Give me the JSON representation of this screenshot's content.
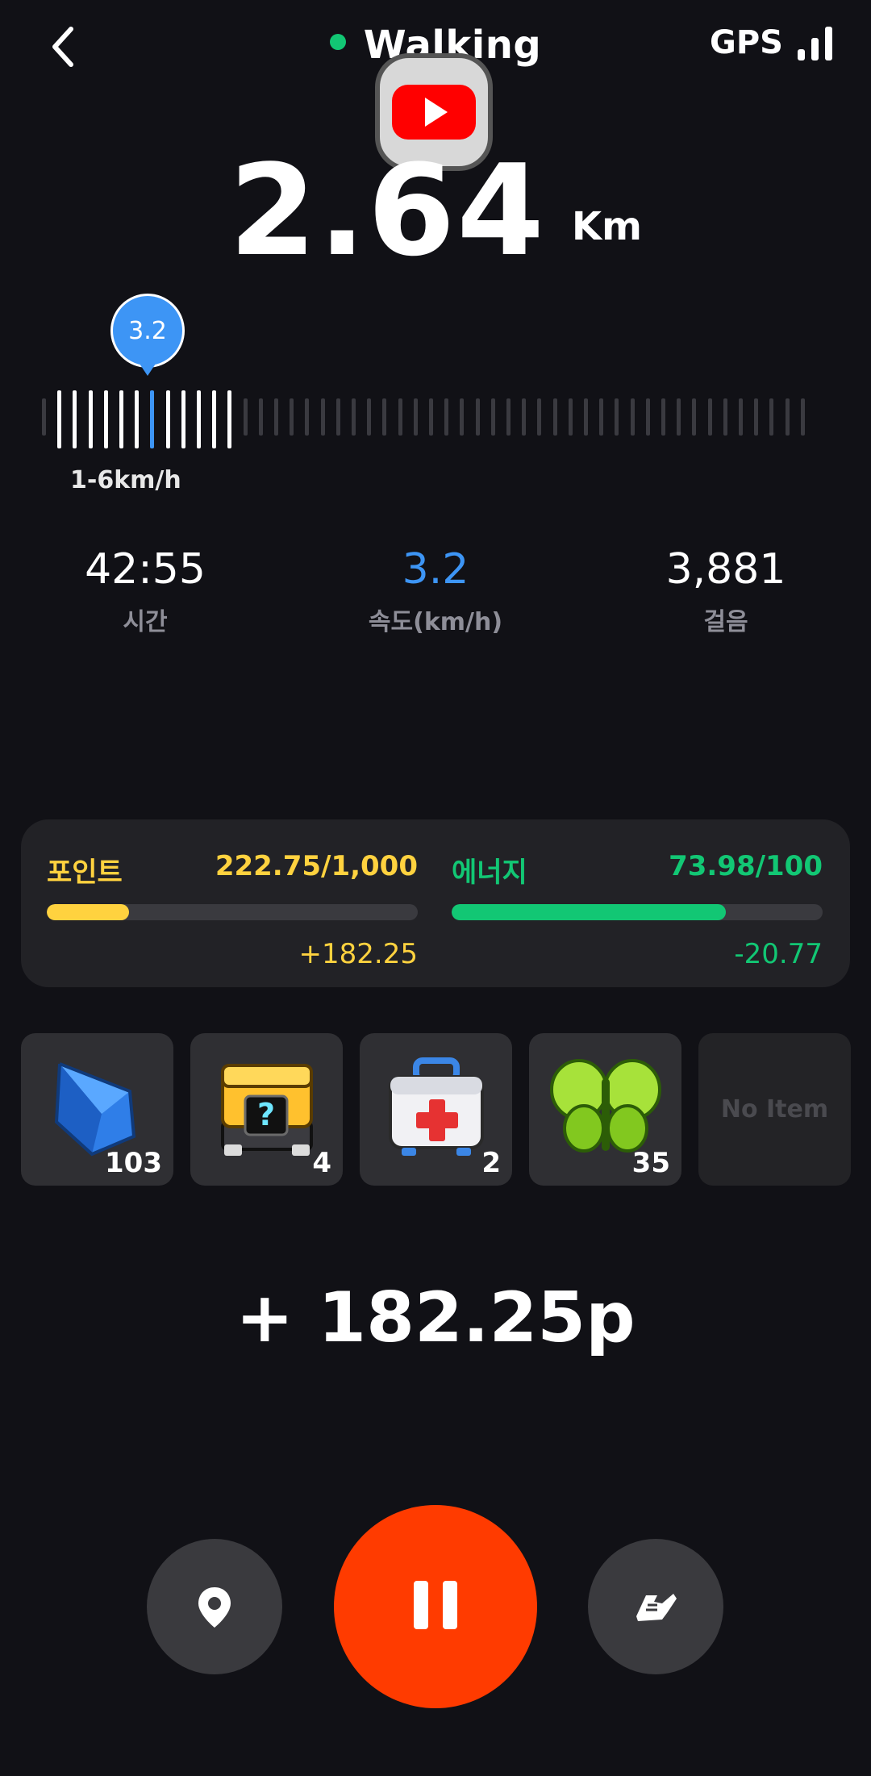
{
  "header": {
    "mode_label": "Walking",
    "gps_label": "GPS",
    "icons": {
      "back": "chevron-left-icon",
      "gps_signal": "signal-bars-icon",
      "overlay": "youtube-icon"
    }
  },
  "distance": {
    "value": "2.64",
    "unit": "Km"
  },
  "speed_gauge": {
    "current": "3.2",
    "range_label": "1-6km/h",
    "level_fraction": 0.53
  },
  "stats": [
    {
      "value": "42:55",
      "label": "시간"
    },
    {
      "value": "3.2",
      "label": "속도(km/h)"
    },
    {
      "value": "3,881",
      "label": "걸음"
    }
  ],
  "points": {
    "label": "포인트",
    "value": "222.75/1,000",
    "delta": "+182.25",
    "fill": 0.22275,
    "color": "#ffd23f"
  },
  "energy": {
    "label": "에너지",
    "value": "73.98/100",
    "delta": "-20.77",
    "fill": 0.7398,
    "color": "#12c774"
  },
  "items": [
    {
      "icon": "blue-crystal-icon",
      "count": "103"
    },
    {
      "icon": "mystery-box-icon",
      "count": "4"
    },
    {
      "icon": "first-aid-kit-icon",
      "count": "2"
    },
    {
      "icon": "butterfly-icon",
      "count": "35"
    },
    {
      "icon": "",
      "count": "",
      "empty_label": "No Item"
    }
  ],
  "earned_text": "+ 182.25p",
  "controls": {
    "left_icon": "location-pin-icon",
    "center_icon": "pause-icon",
    "right_icon": "sneaker-icon"
  },
  "colors": {
    "accent_blue": "#3d95f5",
    "pause_red": "#ff3b00",
    "background": "#111116"
  }
}
